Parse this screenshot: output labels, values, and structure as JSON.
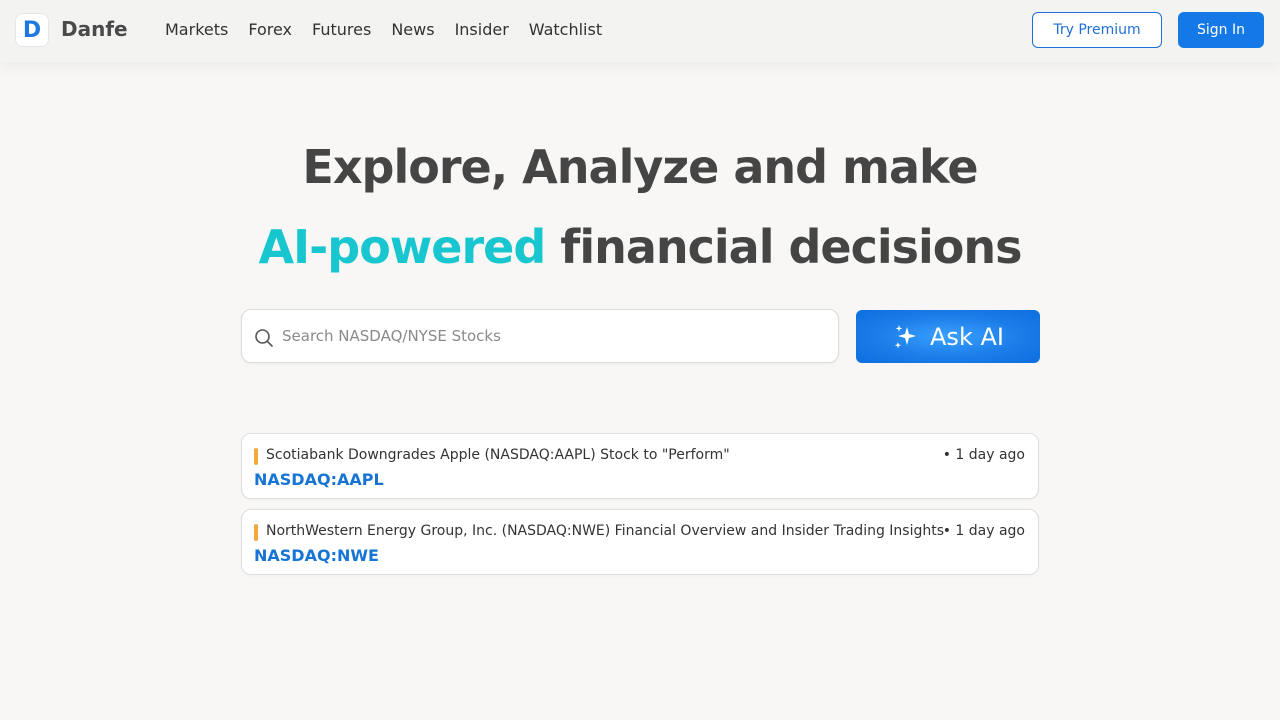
{
  "header": {
    "logo_letter": "D",
    "brand": "Danfe",
    "nav": [
      "Markets",
      "Forex",
      "Futures",
      "News",
      "Insider",
      "Watchlist"
    ],
    "try_premium": "Try Premium",
    "sign_in": "Sign In"
  },
  "hero": {
    "line1": "Explore, Analyze and make",
    "accent": "AI-powered",
    "line2_rest": " financial decisions"
  },
  "search": {
    "placeholder": "Search NASDAQ/NYSE Stocks",
    "value": ""
  },
  "ask_ai": {
    "label": "Ask AI"
  },
  "news": [
    {
      "title": "Scotiabank Downgrades Apple (NASDAQ:AAPL) Stock to \"Perform\"",
      "time": "• 1 day ago",
      "ticker": "NASDAQ:AAPL"
    },
    {
      "title": "NorthWestern Energy Group, Inc. (NASDAQ:NWE) Financial Overview and Insider Trading Insights",
      "time": "• 1 day ago",
      "ticker": "NASDAQ:NWE"
    }
  ],
  "colors": {
    "accent_cyan": "#17c6cf",
    "primary_blue": "#1479e6",
    "ticker_blue": "#1574d4",
    "news_marker": "#f4a93a"
  }
}
